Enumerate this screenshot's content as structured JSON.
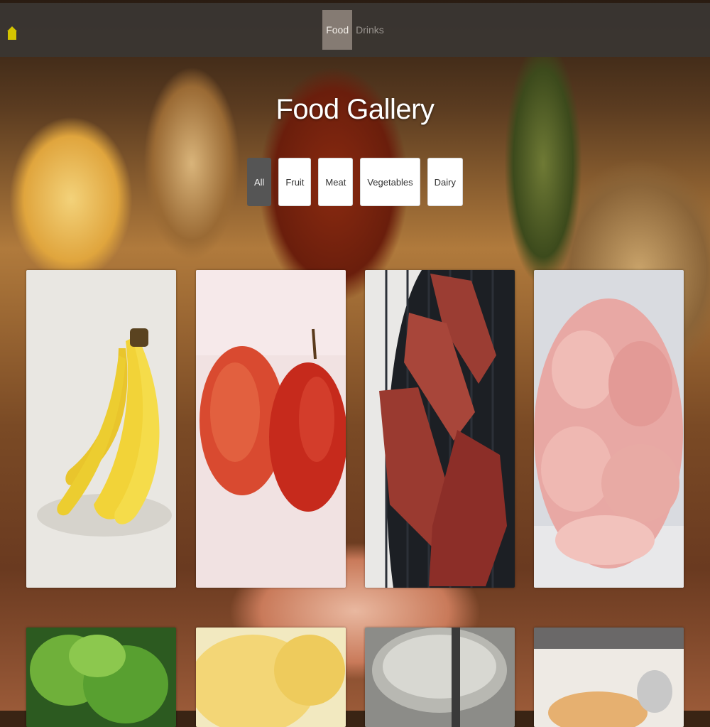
{
  "nav": {
    "home_icon": "home-icon",
    "items": [
      {
        "label": "Food",
        "active": true
      },
      {
        "label": "Drinks",
        "active": false
      }
    ]
  },
  "gallery": {
    "title": "Food Gallery",
    "filters": [
      {
        "label": "All",
        "active": true
      },
      {
        "label": "Fruit",
        "active": false
      },
      {
        "label": "Meat",
        "active": false
      },
      {
        "label": "Vegetables",
        "active": false
      },
      {
        "label": "Dairy",
        "active": false
      }
    ],
    "items": [
      {
        "subject": "bananas"
      },
      {
        "subject": "apples"
      },
      {
        "subject": "grilled-meat"
      },
      {
        "subject": "raw-chicken"
      },
      {
        "subject": "lettuce"
      },
      {
        "subject": "bread"
      },
      {
        "subject": "measuring-cup"
      },
      {
        "subject": "dairy-bowl"
      }
    ]
  },
  "colors": {
    "topbar": "#3a3632",
    "nav_active": "#857b73",
    "home_icon": "#d4c400",
    "filter_active": "#555555",
    "title": "#ffffff"
  }
}
